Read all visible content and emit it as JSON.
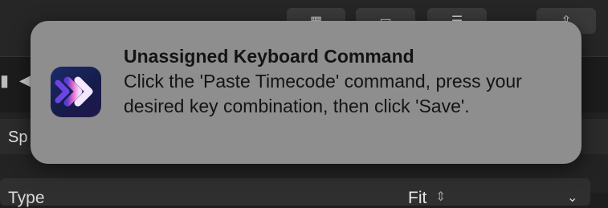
{
  "notification": {
    "title": "Unassigned Keyboard Command",
    "body": "Click the 'Paste Timecode' command, press your desired key combination, then click 'Save'.",
    "app_icon": "chevron-arrow-app-icon"
  },
  "inspector": {
    "section_label": "Sp",
    "type_label": "Type",
    "type_value": "Fit"
  },
  "icons": {
    "toolbar": [
      "grid-icon",
      "tab-icon",
      "bars-icon",
      "share-icon"
    ],
    "film": "film-strip-icon",
    "speaker": "speaker-icon",
    "updown": "updown-icon",
    "chevron": "chevron-down-icon"
  },
  "colors": {
    "banner_bg": "#8e8e8e",
    "app_bg": "#1e1e1e"
  }
}
